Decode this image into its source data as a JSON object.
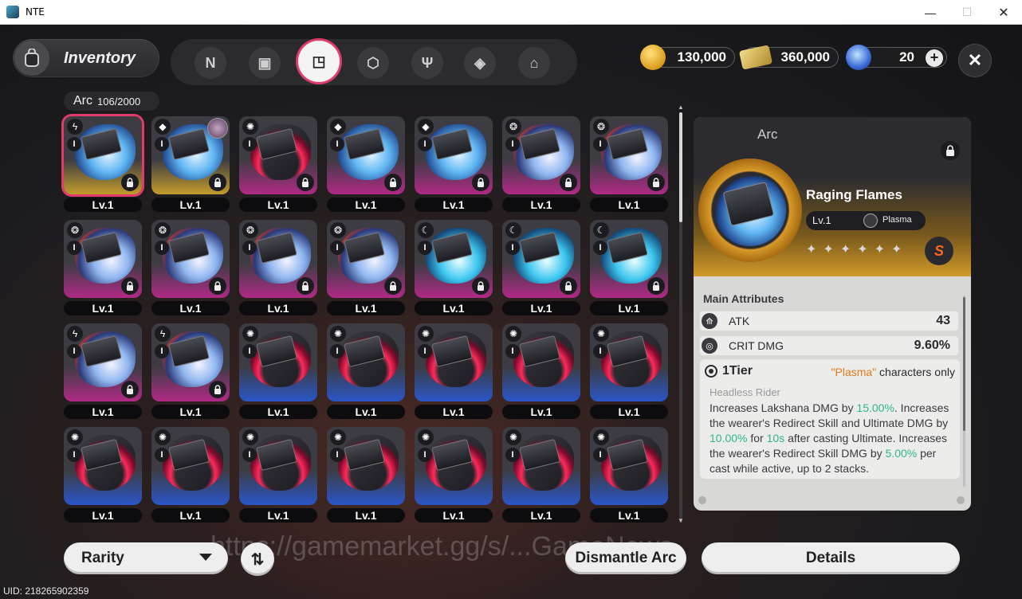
{
  "window": {
    "title": "NTE",
    "minimize": "—",
    "maximize": "☐",
    "close": "✕"
  },
  "header": {
    "section_label": "Inventory",
    "categories": [
      {
        "name": "N",
        "active": false
      },
      {
        "name": "▣",
        "active": false
      },
      {
        "name": "◳",
        "active": true
      },
      {
        "name": "⬡",
        "active": false
      },
      {
        "name": "Ψ",
        "active": false
      },
      {
        "name": "◈",
        "active": false
      },
      {
        "name": "⌂",
        "active": false
      }
    ],
    "currency": {
      "gold": "130,000",
      "tickets": "360,000",
      "gems": "20",
      "plus": "+"
    },
    "close": "✕"
  },
  "arc_count": {
    "label": "Arc",
    "value": "106/2000"
  },
  "grid_items": [
    {
      "rarity": "gold",
      "art": "ice",
      "level": "Lv.1",
      "selected": true,
      "element": "plasma"
    },
    {
      "rarity": "gold",
      "art": "ice",
      "level": "Lv.1",
      "selected": false,
      "element": "cube",
      "avatar": true
    },
    {
      "rarity": "purple",
      "art": "red",
      "level": "Lv.1",
      "selected": false,
      "element": "gear"
    },
    {
      "rarity": "purple",
      "art": "ice",
      "level": "Lv.1",
      "selected": false,
      "element": "cube"
    },
    {
      "rarity": "purple",
      "art": "ice",
      "level": "Lv.1",
      "selected": false,
      "element": "cube"
    },
    {
      "rarity": "purple",
      "art": "fire",
      "level": "Lv.1",
      "selected": false,
      "element": "swirl"
    },
    {
      "rarity": "purple",
      "art": "fire",
      "level": "Lv.1",
      "selected": false,
      "element": "swirl"
    },
    {
      "rarity": "purple",
      "art": "fire",
      "level": "Lv.1",
      "selected": false,
      "element": "swirl"
    },
    {
      "rarity": "purple",
      "art": "fire",
      "level": "Lv.1",
      "selected": false,
      "element": "swirl"
    },
    {
      "rarity": "purple",
      "art": "fire",
      "level": "Lv.1",
      "selected": false,
      "element": "swirl"
    },
    {
      "rarity": "purple",
      "art": "fire",
      "level": "Lv.1",
      "selected": false,
      "element": "swirl"
    },
    {
      "rarity": "purple",
      "art": "cyan",
      "level": "Lv.1",
      "selected": false,
      "element": "moon"
    },
    {
      "rarity": "purple",
      "art": "cyan",
      "level": "Lv.1",
      "selected": false,
      "element": "moon"
    },
    {
      "rarity": "purple",
      "art": "cyan",
      "level": "Lv.1",
      "selected": false,
      "element": "moon"
    },
    {
      "rarity": "purple",
      "art": "fire",
      "level": "Lv.1",
      "selected": false,
      "element": "plasma"
    },
    {
      "rarity": "purple",
      "art": "fire",
      "level": "Lv.1",
      "selected": false,
      "element": "plasma"
    },
    {
      "rarity": "blue",
      "art": "red",
      "level": "Lv.1",
      "selected": false,
      "element": "gear"
    },
    {
      "rarity": "blue",
      "art": "red",
      "level": "Lv.1",
      "selected": false,
      "element": "gear"
    },
    {
      "rarity": "blue",
      "art": "red",
      "level": "Lv.1",
      "selected": false,
      "element": "gear"
    },
    {
      "rarity": "blue",
      "art": "red",
      "level": "Lv.1",
      "selected": false,
      "element": "gear"
    },
    {
      "rarity": "blue",
      "art": "red",
      "level": "Lv.1",
      "selected": false,
      "element": "gear"
    },
    {
      "rarity": "blue",
      "art": "red",
      "level": "Lv.1",
      "selected": false,
      "element": "gear"
    },
    {
      "rarity": "blue",
      "art": "red",
      "level": "Lv.1",
      "selected": false,
      "element": "gear"
    },
    {
      "rarity": "blue",
      "art": "red",
      "level": "Lv.1",
      "selected": false,
      "element": "gear"
    },
    {
      "rarity": "blue",
      "art": "red",
      "level": "Lv.1",
      "selected": false,
      "element": "gear"
    },
    {
      "rarity": "blue",
      "art": "red",
      "level": "Lv.1",
      "selected": false,
      "element": "gear"
    },
    {
      "rarity": "blue",
      "art": "red",
      "level": "Lv.1",
      "selected": false,
      "element": "gear"
    },
    {
      "rarity": "blue",
      "art": "red",
      "level": "Lv.1",
      "selected": false,
      "element": "gear"
    }
  ],
  "locked_flags": [
    true,
    true,
    true,
    true,
    true,
    true,
    true,
    true,
    true,
    true,
    true,
    true,
    true,
    true,
    true,
    true,
    false,
    false,
    false,
    false,
    false,
    false,
    false,
    false,
    false,
    false,
    false,
    false
  ],
  "detail": {
    "type_label": "Arc",
    "name": "Raging Flames",
    "level": "Lv.1",
    "element": "Plasma",
    "stars": "✦✦✦✦✦✦",
    "rank_badge": "S",
    "main_attributes_title": "Main Attributes",
    "attributes": [
      {
        "name": "ATK",
        "value": "43",
        "icon": "atk-icon"
      },
      {
        "name": "CRIT DMG",
        "value": "9.60%",
        "icon": "crit-icon"
      }
    ],
    "effect": {
      "tier": "1Tier",
      "condition_prefix": "\"Plasma\"",
      "condition_suffix": " characters only",
      "subtitle": "Headless Rider",
      "t1": "Increases Lakshana DMG by ",
      "v1": "15.00%",
      "t2": ". Increases the wearer's Redirect Skill and Ultimate DMG by ",
      "v2": "10.00%",
      "t3": " for ",
      "v3": "10s",
      "t4": " after casting Ultimate. Increases the wearer's Redirect Skill DMG by ",
      "v4": "5.00%",
      "t5": " per cast while active, up to 2 stacks."
    }
  },
  "bottom": {
    "rarity_label": "Rarity",
    "sort_icon": "⇅",
    "dismantle_label": "Dismantle Arc",
    "details_label": "Details",
    "watermark": "https://gamemarket.gg/s/...GameNews"
  },
  "uid": "UID: 218265902359"
}
